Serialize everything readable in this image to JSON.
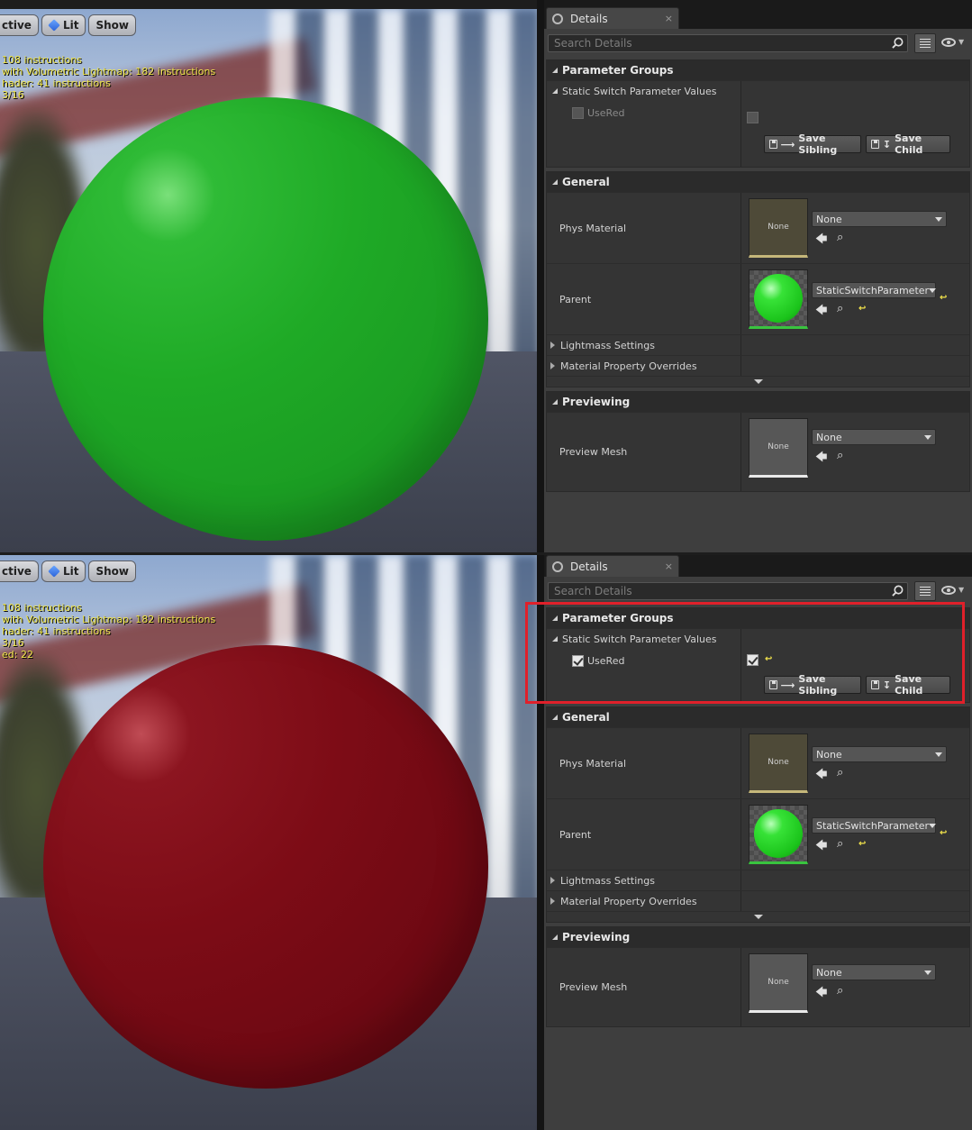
{
  "viewport": {
    "toolbar": {
      "view_mode": "ctive",
      "lit": "Lit",
      "show": "Show"
    },
    "stats_top": [
      "108 instructions",
      "with Volumetric Lightmap: 182 instructions",
      "hader: 41 instructions",
      "3/16"
    ],
    "stats_bottom": [
      "108 instructions",
      "with Volumetric Lightmap: 182 instructions",
      "hader: 41 instructions",
      "3/16",
      "ed: 22"
    ],
    "top_sphere_color": "#1faa26",
    "bottom_sphere_color": "#7d0c16"
  },
  "details": {
    "tab_label": "Details",
    "tab_close": "×",
    "search_placeholder": "Search Details",
    "parameter_groups": {
      "title": "Parameter Groups",
      "static_switch_label": "Static Switch Parameter Values",
      "use_red_label": "UseRed",
      "save_sibling": "Save Sibling",
      "save_child": "Save Child"
    },
    "general": {
      "title": "General",
      "phys_material_label": "Phys Material",
      "phys_material_value": "None",
      "phys_thumb": "None",
      "parent_label": "Parent",
      "parent_value": "StaticSwitchParameter",
      "lightmass_label": "Lightmass Settings",
      "overrides_label": "Material Property Overrides"
    },
    "previewing": {
      "title": "Previewing",
      "preview_mesh_label": "Preview Mesh",
      "preview_mesh_value": "None",
      "mesh_thumb": "None"
    }
  },
  "state": {
    "top_use_red": false,
    "bottom_use_red": true,
    "highlight_color": "#e0202a"
  }
}
